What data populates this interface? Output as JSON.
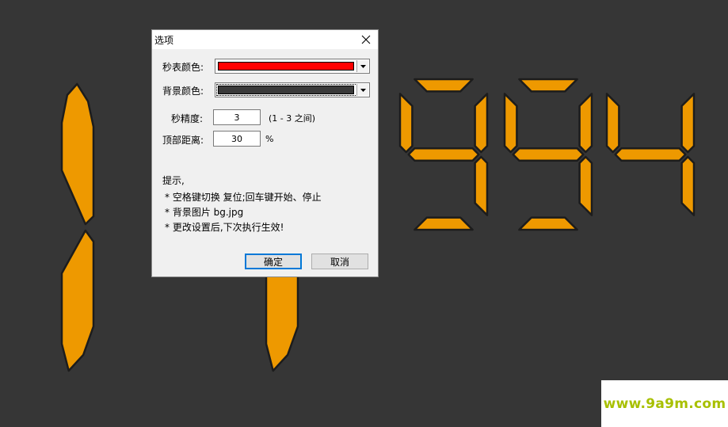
{
  "clock": {
    "digits": [
      "1",
      "1",
      "9",
      "9",
      "4"
    ],
    "segment_color": "#ee9900",
    "background_color": "#363636"
  },
  "dialog": {
    "title": "选项",
    "close_icon": "close-icon",
    "fields": {
      "stopwatch_color_label": "秒表颜色:",
      "stopwatch_color_value": "#ff0000",
      "background_color_label": "背景颜色:",
      "background_color_value": "#3a3a3a",
      "precision_label": "秒精度:",
      "precision_value": "3",
      "precision_hint": "(1 - 3 之间)",
      "top_distance_label": "顶部距离:",
      "top_distance_value": "30",
      "top_distance_unit": "%"
    },
    "tips": {
      "heading": "提示,",
      "lines": [
        "* 空格键切换 复位;回车键开始、停止",
        "* 背景图片 bg.jpg",
        "* 更改设置后,下次执行生效!"
      ]
    },
    "buttons": {
      "ok": "确定",
      "cancel": "取消"
    }
  },
  "watermark": {
    "text": "www.9a9m.com",
    "color": "#a8c000"
  }
}
